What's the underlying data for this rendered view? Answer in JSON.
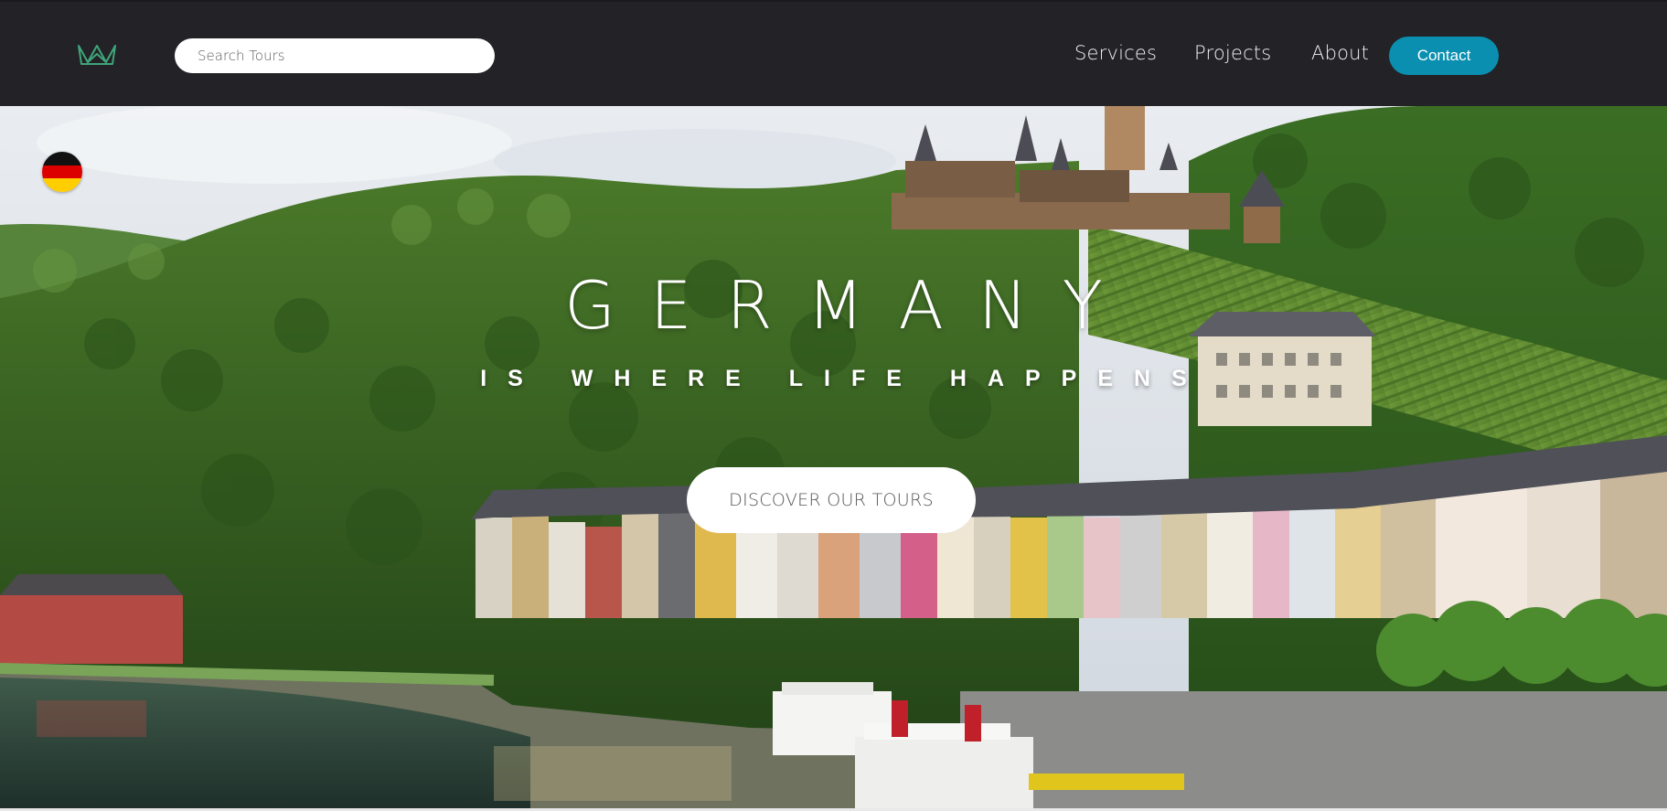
{
  "header": {
    "logo_icon": "crown-icon",
    "search": {
      "placeholder": "Search Tours",
      "value": ""
    },
    "nav": [
      {
        "label": "Services"
      },
      {
        "label": "Projects"
      },
      {
        "label": "About"
      }
    ],
    "contact_label": "Contact"
  },
  "hero": {
    "flag_icon": "germany-flag-icon",
    "title": "GERMANY",
    "subtitle": "IS WHERE LIFE HAPPENS",
    "cta_label": "DISCOVER OUR TOURS"
  },
  "colors": {
    "header_bg": "#232327",
    "accent": "#0a8fb0",
    "logo_green": "#3fa67b",
    "foliage": "#2f5e1f"
  }
}
